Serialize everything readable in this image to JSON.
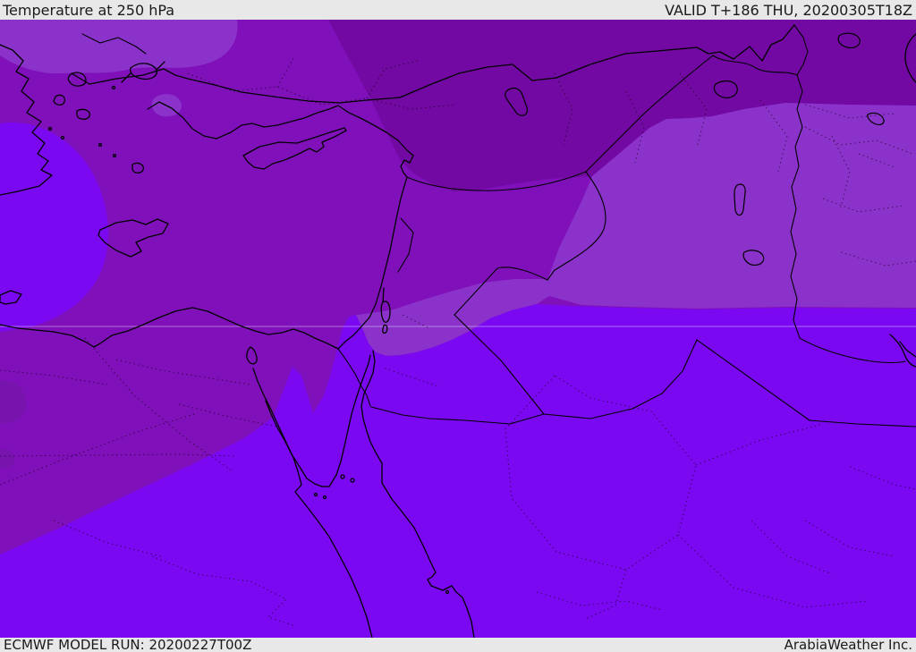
{
  "header": {
    "title": "Temperature at 250 hPa",
    "valid": "VALID T+186 THU, 20200305T18Z"
  },
  "footer": {
    "model_run": "ECMWF MODEL RUN: 20200227T00Z",
    "brand": "ArabiaWeather Inc."
  },
  "map": {
    "parameter": "Temperature",
    "level": "250 hPa",
    "model": "ECMWF",
    "region": "Middle East / Eastern Mediterranean",
    "palette": {
      "band_coldest": "#7209A2",
      "band_cold": "#7F10BA",
      "band_mid": "#8B32CB",
      "band_warm": "#7A09F2",
      "band_west_patch": "#7714AE",
      "coastline": "#000000",
      "graticule": "rgba(255,255,255,0.40)",
      "dotted_admin": "#140016",
      "bar_bg": "#e8e8e8",
      "bar_text": "#1a1a1a"
    }
  }
}
